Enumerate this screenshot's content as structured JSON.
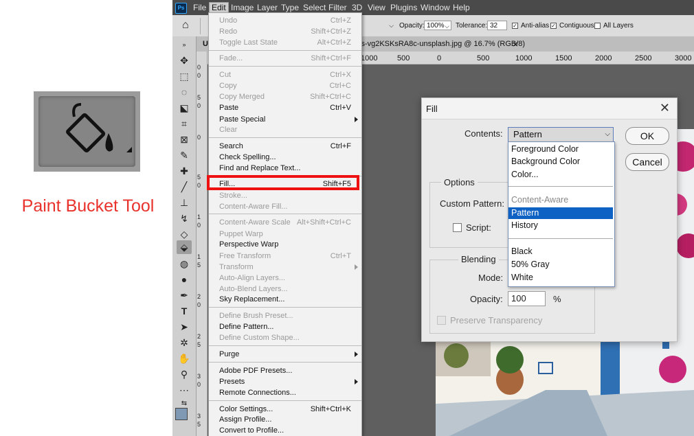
{
  "annotation": {
    "caption": "Paint Bucket Tool"
  },
  "menubar": {
    "logo": "Ps",
    "items": [
      "File",
      "Edit",
      "Image",
      "Layer",
      "Type",
      "Select",
      "Filter",
      "3D",
      "View",
      "Plugins",
      "Window",
      "Help"
    ]
  },
  "options_bar": {
    "opacity_label": "Opacity:",
    "opacity_value": "100%",
    "tolerance_label": "Tolerance:",
    "tolerance_value": "32",
    "anti_alias": "Anti-alias",
    "contiguous": "Contiguous",
    "all_layers": "All Layers"
  },
  "document_tab": {
    "left_stub": "U",
    "title": "is-vg2KSKsRA8c-unsplash.jpg @ 16.7% (RGB/8)",
    "close": "×"
  },
  "ruler_labels": [
    "1000",
    "500",
    "0",
    "500",
    "1000",
    "1500",
    "2000",
    "2500",
    "3000"
  ],
  "vruler_labels": [
    "0",
    "0",
    "5",
    "0",
    "0",
    "5",
    "0",
    "1",
    "0",
    "1",
    "5",
    "2",
    "0",
    "2",
    "5",
    "3",
    "0",
    "3",
    "5",
    "4"
  ],
  "edit_menu": {
    "items": [
      {
        "label": "Undo",
        "shortcut": "Ctrl+Z",
        "enabled": false
      },
      {
        "label": "Redo",
        "shortcut": "Shift+Ctrl+Z",
        "enabled": false
      },
      {
        "label": "Toggle Last State",
        "shortcut": "Alt+Ctrl+Z",
        "enabled": false
      },
      {
        "label": "Fade...",
        "shortcut": "Shift+Ctrl+F",
        "enabled": false
      },
      {
        "label": "Cut",
        "shortcut": "Ctrl+X",
        "enabled": false
      },
      {
        "label": "Copy",
        "shortcut": "Ctrl+C",
        "enabled": false
      },
      {
        "label": "Copy Merged",
        "shortcut": "Shift+Ctrl+C",
        "enabled": false
      },
      {
        "label": "Paste",
        "shortcut": "Ctrl+V",
        "enabled": true
      },
      {
        "label": "Paste Special",
        "shortcut": "",
        "enabled": true,
        "submenu": true
      },
      {
        "label": "Clear",
        "shortcut": "",
        "enabled": false
      },
      {
        "label": "Search",
        "shortcut": "Ctrl+F",
        "enabled": true
      },
      {
        "label": "Check Spelling...",
        "shortcut": "",
        "enabled": true
      },
      {
        "label": "Find and Replace Text...",
        "shortcut": "",
        "enabled": true
      },
      {
        "label": "Fill...",
        "shortcut": "Shift+F5",
        "enabled": true,
        "highlighted": true
      },
      {
        "label": "Stroke...",
        "shortcut": "",
        "enabled": false
      },
      {
        "label": "Content-Aware Fill...",
        "shortcut": "",
        "enabled": false
      },
      {
        "label": "Content-Aware Scale",
        "shortcut": "Alt+Shift+Ctrl+C",
        "enabled": false
      },
      {
        "label": "Puppet Warp",
        "shortcut": "",
        "enabled": false
      },
      {
        "label": "Perspective Warp",
        "shortcut": "",
        "enabled": true
      },
      {
        "label": "Free Transform",
        "shortcut": "Ctrl+T",
        "enabled": false
      },
      {
        "label": "Transform",
        "shortcut": "",
        "enabled": false,
        "submenu": true
      },
      {
        "label": "Auto-Align Layers...",
        "shortcut": "",
        "enabled": false
      },
      {
        "label": "Auto-Blend Layers...",
        "shortcut": "",
        "enabled": false
      },
      {
        "label": "Sky Replacement...",
        "shortcut": "",
        "enabled": true
      },
      {
        "label": "Define Brush Preset...",
        "shortcut": "",
        "enabled": false
      },
      {
        "label": "Define Pattern...",
        "shortcut": "",
        "enabled": true
      },
      {
        "label": "Define Custom Shape...",
        "shortcut": "",
        "enabled": false
      },
      {
        "label": "Purge",
        "shortcut": "",
        "enabled": true,
        "submenu": true
      },
      {
        "label": "Adobe PDF Presets...",
        "shortcut": "",
        "enabled": true
      },
      {
        "label": "Presets",
        "shortcut": "",
        "enabled": true,
        "submenu": true
      },
      {
        "label": "Remote Connections...",
        "shortcut": "",
        "enabled": true
      },
      {
        "label": "Color Settings...",
        "shortcut": "Shift+Ctrl+K",
        "enabled": true
      },
      {
        "label": "Assign Profile...",
        "shortcut": "",
        "enabled": true
      },
      {
        "label": "Convert to Profile...",
        "shortcut": "",
        "enabled": true
      }
    ]
  },
  "fill_dialog": {
    "title": "Fill",
    "close": "✕",
    "contents_label": "Contents:",
    "contents_value": "Pattern",
    "ok": "OK",
    "cancel": "Cancel",
    "options_label": "Options",
    "custom_pattern_label": "Custom Pattern:",
    "script_label": "Script:",
    "blending_label": "Blending",
    "mode_label": "Mode:",
    "opacity_label": "Opacity:",
    "opacity_value": "100",
    "opacity_unit": "%",
    "preserve_label": "Preserve Transparency"
  },
  "contents_dropdown": {
    "options": [
      {
        "label": "Foreground Color",
        "enabled": true
      },
      {
        "label": "Background Color",
        "enabled": true
      },
      {
        "label": "Color...",
        "enabled": true
      },
      {
        "label": "Content-Aware",
        "enabled": false
      },
      {
        "label": "Pattern",
        "enabled": true,
        "selected": true
      },
      {
        "label": "History",
        "enabled": true
      },
      {
        "label": "Black",
        "enabled": true
      },
      {
        "label": "50% Gray",
        "enabled": true
      },
      {
        "label": "White",
        "enabled": true
      }
    ]
  },
  "colors": {
    "highlight_red": "#ee1111",
    "caption_red": "#e8322b",
    "selection_blue": "#0e62c4"
  }
}
